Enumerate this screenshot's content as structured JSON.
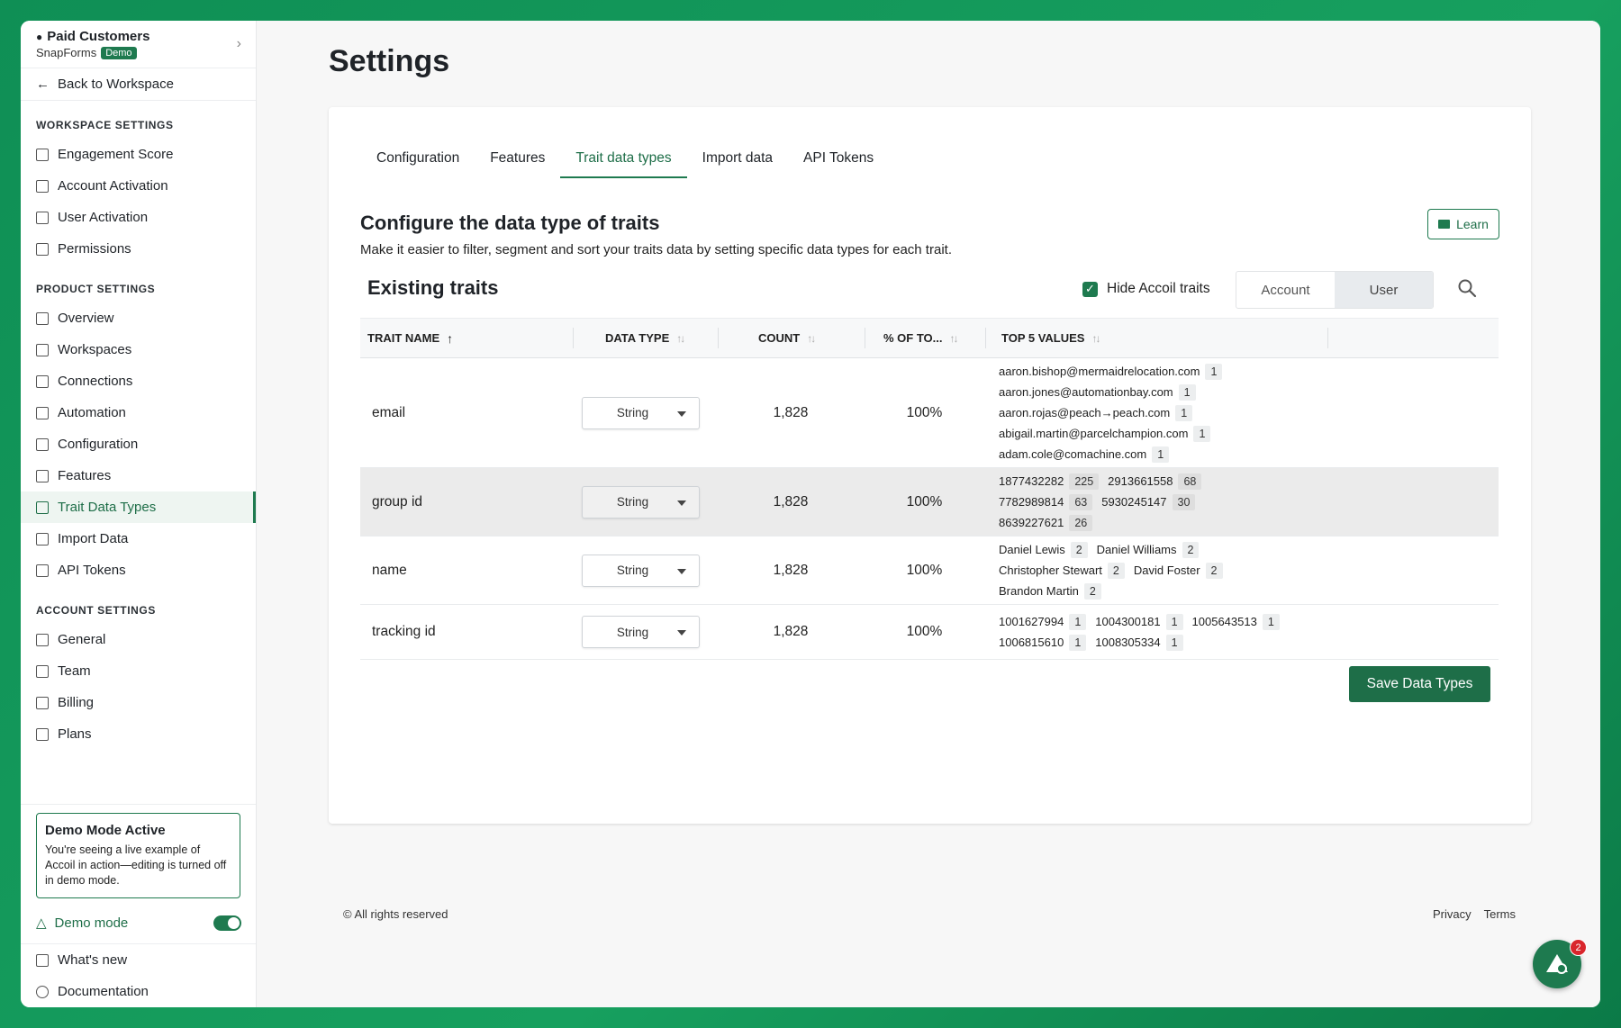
{
  "sidebar": {
    "workspace_name": "Paid Customers",
    "org_name": "SnapForms",
    "demo_badge": "Demo",
    "back_label": "Back to Workspace",
    "sections": [
      {
        "title": "WORKSPACE SETTINGS",
        "items": [
          {
            "label": "Engagement Score",
            "icon": "chart-box-icon"
          },
          {
            "label": "Account Activation",
            "icon": "list-box-icon"
          },
          {
            "label": "User Activation",
            "icon": "user-list-icon"
          },
          {
            "label": "Permissions",
            "icon": "shield-icon"
          }
        ]
      },
      {
        "title": "PRODUCT SETTINGS",
        "items": [
          {
            "label": "Overview",
            "icon": "line-chart-icon"
          },
          {
            "label": "Workspaces",
            "icon": "layout-icon"
          },
          {
            "label": "Connections",
            "icon": "plug-icon"
          },
          {
            "label": "Automation",
            "icon": "automation-icon"
          },
          {
            "label": "Configuration",
            "icon": "grid-icon"
          },
          {
            "label": "Features",
            "icon": "flask-icon"
          },
          {
            "label": "Trait Data Types",
            "icon": "list-icon",
            "active": true
          },
          {
            "label": "Import Data",
            "icon": "cloud-upload-icon"
          },
          {
            "label": "API Tokens",
            "icon": "key-icon"
          }
        ]
      },
      {
        "title": "ACCOUNT SETTINGS",
        "items": [
          {
            "label": "General",
            "icon": "chart-box-icon"
          },
          {
            "label": "Team",
            "icon": "team-icon"
          },
          {
            "label": "Billing",
            "icon": "card-icon"
          },
          {
            "label": "Plans",
            "icon": "tag-icon"
          }
        ]
      }
    ],
    "demo_box": {
      "title": "Demo Mode Active",
      "text": "You're seeing a live example of Accoil in action—editing is turned off in demo mode."
    },
    "demo_mode_label": "Demo mode",
    "whats_new": "What's new",
    "documentation": "Documentation"
  },
  "page": {
    "title": "Settings",
    "tabs": [
      "Configuration",
      "Features",
      "Trait data types",
      "Import data",
      "API Tokens"
    ],
    "active_tab": "Trait data types",
    "config_title": "Configure the data type of traits",
    "config_desc": "Make it easier to filter, segment and sort your traits data by setting specific data types for each trait.",
    "learn_label": "Learn",
    "existing_title": "Existing traits",
    "hide_label": "Hide Accoil traits",
    "seg_account": "Account",
    "seg_user": "User",
    "columns": [
      "TRAIT NAME",
      "DATA TYPE",
      "COUNT",
      "% OF TO...",
      "TOP 5 VALUES"
    ],
    "rows": [
      {
        "name": "email",
        "type": "String",
        "count": "1,828",
        "pct": "100%",
        "lines": [
          [
            {
              "v": "aaron.bishop@mermaidrelocation.com",
              "c": "1"
            }
          ],
          [
            {
              "v": "aaron.jones@automationbay.com",
              "c": "1"
            }
          ],
          [
            {
              "v": "aaron.rojas@peach→peach.com",
              "c": "1"
            }
          ],
          [
            {
              "v": "abigail.martin@parcelchampion.com",
              "c": "1"
            }
          ],
          [
            {
              "v": "adam.cole@comachine.com",
              "c": "1"
            }
          ]
        ]
      },
      {
        "name": "group id",
        "type": "String",
        "count": "1,828",
        "pct": "100%",
        "hl": true,
        "lines": [
          [
            {
              "v": "1877432282",
              "c": "225"
            },
            {
              "v": "2913661558",
              "c": "68"
            }
          ],
          [
            {
              "v": "7782989814",
              "c": "63"
            },
            {
              "v": "5930245147",
              "c": "30"
            }
          ],
          [
            {
              "v": "8639227621",
              "c": "26"
            }
          ]
        ]
      },
      {
        "name": "name",
        "type": "String",
        "count": "1,828",
        "pct": "100%",
        "lines": [
          [
            {
              "v": "Daniel Lewis",
              "c": "2"
            },
            {
              "v": "Daniel Williams",
              "c": "2"
            }
          ],
          [
            {
              "v": "Christopher Stewart",
              "c": "2"
            },
            {
              "v": "David Foster",
              "c": "2"
            }
          ],
          [
            {
              "v": "Brandon Martin",
              "c": "2"
            }
          ]
        ]
      },
      {
        "name": "tracking id",
        "type": "String",
        "count": "1,828",
        "pct": "100%",
        "lines": [
          [
            {
              "v": "1001627994",
              "c": "1"
            },
            {
              "v": "1004300181",
              "c": "1"
            },
            {
              "v": "1005643513",
              "c": "1"
            }
          ],
          [
            {
              "v": "1006815610",
              "c": "1"
            },
            {
              "v": "1008305334",
              "c": "1"
            }
          ]
        ]
      }
    ],
    "save_label": "Save Data Types",
    "copyright": "© All rights reserved",
    "privacy": "Privacy",
    "terms": "Terms",
    "notification_count": "2"
  }
}
